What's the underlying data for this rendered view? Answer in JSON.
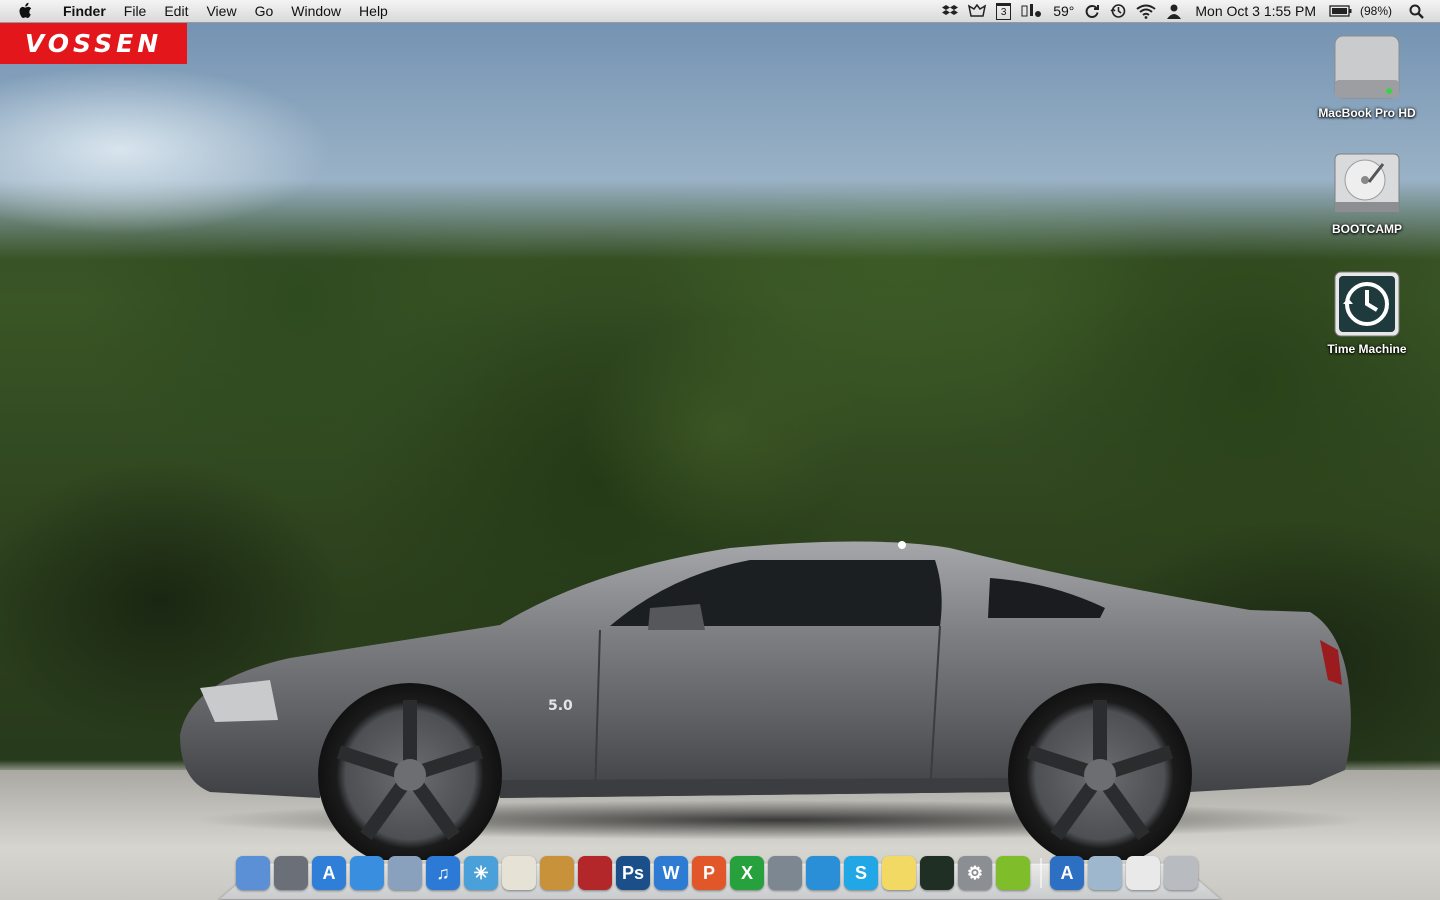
{
  "menubar": {
    "app_name": "Finder",
    "menus": [
      "File",
      "Edit",
      "View",
      "Go",
      "Window",
      "Help"
    ],
    "status": {
      "calendar_day": "3",
      "temperature": "59°",
      "clock": "Mon Oct 3  1:55 PM",
      "battery": "(98%)"
    },
    "status_icons": [
      "dropbox-icon",
      "growl-icon",
      "calendar-icon",
      "weather-icon",
      "sync-icon",
      "time-machine-icon",
      "wifi-icon",
      "user-icon",
      "battery-icon",
      "spotlight-icon"
    ]
  },
  "wallpaper": {
    "brand": "VOSSEN",
    "badge": "5.0"
  },
  "desktop_icons": [
    {
      "label": "MacBook Pro HD",
      "icon": "internal-drive-icon"
    },
    {
      "label": "BOOTCAMP",
      "icon": "hard-drive-icon"
    },
    {
      "label": "Time Machine",
      "icon": "time-machine-drive-icon"
    }
  ],
  "dock": {
    "apps": [
      {
        "name": "finder-icon",
        "glyph": "",
        "color": "#5b8fd6"
      },
      {
        "name": "launchpad-icon",
        "glyph": "",
        "color": "#6b6f77"
      },
      {
        "name": "app-store-icon",
        "glyph": "A",
        "color": "#2f7fd8"
      },
      {
        "name": "safari-icon",
        "glyph": "",
        "color": "#3a8ee0"
      },
      {
        "name": "mail-icon",
        "glyph": "",
        "color": "#8aa1bd"
      },
      {
        "name": "itunes-icon",
        "glyph": "♫",
        "color": "#2c7ad6"
      },
      {
        "name": "network-icon",
        "glyph": "✳",
        "color": "#4aa0d8"
      },
      {
        "name": "textedit-icon",
        "glyph": "",
        "color": "#e6e2d6"
      },
      {
        "name": "iphoto-icon",
        "glyph": "",
        "color": "#c8923a"
      },
      {
        "name": "photo-booth-icon",
        "glyph": "",
        "color": "#b3262a"
      },
      {
        "name": "photoshop-icon",
        "glyph": "Ps",
        "color": "#1a4f8a"
      },
      {
        "name": "word-icon",
        "glyph": "W",
        "color": "#2d7bd3"
      },
      {
        "name": "powerpoint-icon",
        "glyph": "P",
        "color": "#e2572a"
      },
      {
        "name": "excel-icon",
        "glyph": "X",
        "color": "#27a13e"
      },
      {
        "name": "disk-utility-icon",
        "glyph": "",
        "color": "#7d8791"
      },
      {
        "name": "twitter-icon",
        "glyph": "",
        "color": "#2a8fd6"
      },
      {
        "name": "skype-icon",
        "glyph": "S",
        "color": "#22a7e6"
      },
      {
        "name": "stickies-icon",
        "glyph": "",
        "color": "#f1d964"
      },
      {
        "name": "activity-monitor-icon",
        "glyph": "",
        "color": "#1f2f24"
      },
      {
        "name": "system-preferences-icon",
        "glyph": "⚙",
        "color": "#8b8e93"
      },
      {
        "name": "spotify-icon",
        "glyph": "",
        "color": "#7fbd2a"
      }
    ],
    "stacks": [
      {
        "name": "applications-folder-icon",
        "glyph": "A",
        "color": "#2d6fc2"
      },
      {
        "name": "documents-folder-icon",
        "glyph": "",
        "color": "#9fb7cd"
      },
      {
        "name": "downloads-stack-icon",
        "glyph": "",
        "color": "#e9e9e9"
      },
      {
        "name": "trash-icon",
        "glyph": "",
        "color": "#b8bcc0"
      }
    ]
  }
}
